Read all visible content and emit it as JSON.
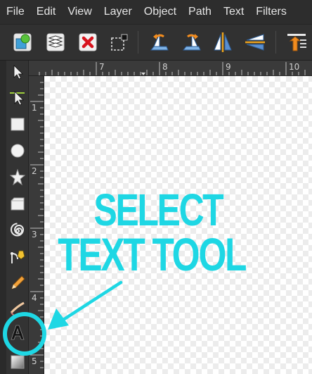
{
  "menu": [
    "File",
    "Edit",
    "View",
    "Layer",
    "Object",
    "Path",
    "Text",
    "Filters"
  ],
  "toolbar": {
    "buttons": [
      "new-document-icon",
      "layers-stack-icon",
      "delete-icon",
      "select-dashed-icon",
      "rotate-ccw-icon",
      "rotate-cw-icon",
      "flip-horizontal-icon",
      "flip-vertical-icon",
      "raise-to-top-icon"
    ]
  },
  "tools": [
    "selector-arrow-icon",
    "node-editor-icon",
    "rectangle-icon",
    "ellipse-icon",
    "star-icon",
    "box3d-icon",
    "spiral-icon",
    "pen-bezier-icon",
    "pencil-icon",
    "calligraphy-icon",
    "text-tool-icon",
    "gradient-icon"
  ],
  "ruler": {
    "top": [
      "7",
      "8",
      "9",
      "10"
    ],
    "left": [
      "1",
      "2",
      "3",
      "4",
      "5"
    ]
  },
  "annotation": {
    "line1": "SELECT",
    "line2": "TEXT TOOL",
    "color": "#1ed7e4"
  }
}
